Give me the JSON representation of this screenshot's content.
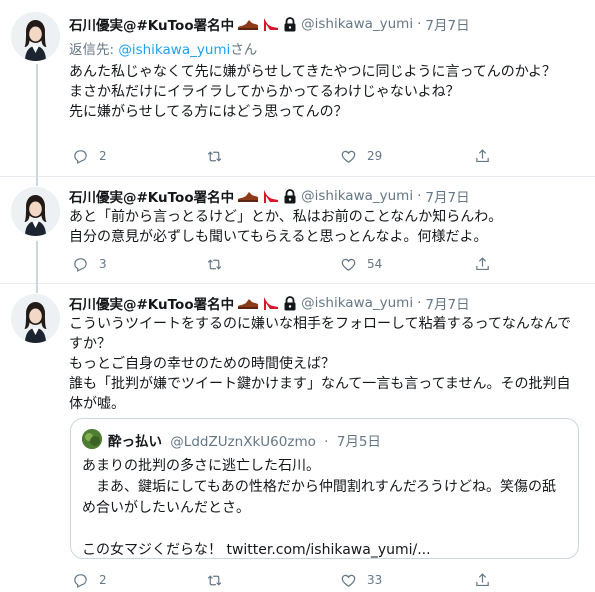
{
  "tweets": [
    {
      "author": "石川優実@#KuToo署名中",
      "handle": "@ishikawa_yumi",
      "separator": "·",
      "date": "7月7日",
      "replying_prefix": "返信先: ",
      "replying_handle": "@ishikawa_yumi",
      "replying_suffix": "さん",
      "text": "あんた私じゃなくて先に嫌がらせしてきたやつに同じように言ってんのかよ？\nまさか私だけにイライラしてからかってるわけじゃないよね？\n先に嫌がらせしてる方にはどう思ってんの？",
      "replies": "2",
      "retweets": "",
      "likes": "29"
    },
    {
      "author": "石川優実@#KuToo署名中",
      "handle": "@ishikawa_yumi",
      "separator": "·",
      "date": "7月7日",
      "text": "あと「前から言っとるけど」とか、私はお前のことなんか知らんわ。\n自分の意見が必ずしも聞いてもらえると思っとんなよ。何様だよ。",
      "replies": "3",
      "retweets": "",
      "likes": "54"
    },
    {
      "author": "石川優実@#KuToo署名中",
      "handle": "@ishikawa_yumi",
      "separator": "·",
      "date": "7月7日",
      "text": "こういうツイートをするのに嫌いな相手をフォローして粘着するってなんなんですか？\nもっとご自身の幸せのための時間使えば？\n誰も「批判が嫌でツイート鍵かけます」なんて一言も言ってません。その批判自体が嘘。",
      "replies": "2",
      "retweets": "",
      "likes": "33",
      "quote": {
        "author": "酔っ払い",
        "handle": "@LddZUznXkU60zmo",
        "separator": "·",
        "date": "7月5日",
        "text": "あまりの批判の多さに逃亡した石川。\n　まあ、鍵垢にしてもあの性格だから仲間割れすんだろうけどね。笑傷の舐め合いがしたいんだとさ。\n\nこの女マジくだらな！ twitter.com/ishikawa_yumi/..."
      }
    }
  ],
  "icons": [
    "reply-icon",
    "retweet-icon",
    "like-icon",
    "share-icon",
    "shoe-emoji-icon",
    "high-heel-emoji-icon",
    "lock-icon"
  ],
  "colors": {
    "link": "#1da1f2",
    "muted": "#657786",
    "border": "#e6ecf0"
  }
}
